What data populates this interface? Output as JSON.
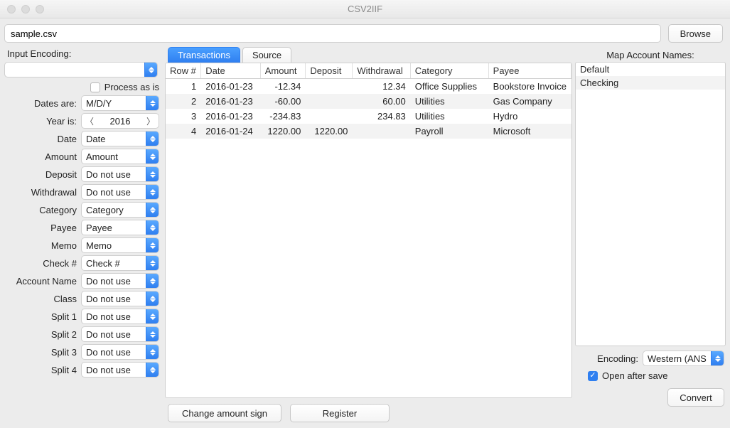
{
  "window": {
    "title": "CSV2IIF"
  },
  "file": {
    "value": "sample.csv",
    "browse_label": "Browse"
  },
  "encoding_label": "Input Encoding:",
  "input_encoding_value": "",
  "process_as_is": {
    "label": "Process as is",
    "checked": false
  },
  "dates_are": {
    "label": "Dates are:",
    "value": "M/D/Y"
  },
  "year_is": {
    "label": "Year is:",
    "value": "2016"
  },
  "mappings": [
    {
      "label": "Date",
      "value": "Date"
    },
    {
      "label": "Amount",
      "value": "Amount"
    },
    {
      "label": "Deposit",
      "value": "Do not use"
    },
    {
      "label": "Withdrawal",
      "value": "Do not use"
    },
    {
      "label": "Category",
      "value": "Category"
    },
    {
      "label": "Payee",
      "value": "Payee"
    },
    {
      "label": "Memo",
      "value": "Memo"
    },
    {
      "label": "Check #",
      "value": "Check #"
    },
    {
      "label": "Account Name",
      "value": "Do not use"
    },
    {
      "label": "Class",
      "value": "Do not use"
    },
    {
      "label": "Split 1",
      "value": "Do not use"
    },
    {
      "label": "Split 2",
      "value": "Do not use"
    },
    {
      "label": "Split 3",
      "value": "Do not use"
    },
    {
      "label": "Split 4",
      "value": "Do not use"
    }
  ],
  "tabs": {
    "transactions": "Transactions",
    "source": "Source"
  },
  "columns": {
    "row": "Row #",
    "date": "Date",
    "amount": "Amount",
    "deposit": "Deposit",
    "withdrawal": "Withdrawal",
    "category": "Category",
    "payee": "Payee"
  },
  "rows": [
    {
      "row": "1",
      "date": "2016-01-23",
      "amount": "-12.34",
      "deposit": "",
      "withdrawal": "12.34",
      "category": "Office Supplies",
      "payee": "Bookstore Invoice"
    },
    {
      "row": "2",
      "date": "2016-01-23",
      "amount": "-60.00",
      "deposit": "",
      "withdrawal": "60.00",
      "category": "Utilities",
      "payee": "Gas Company"
    },
    {
      "row": "3",
      "date": "2016-01-23",
      "amount": "-234.83",
      "deposit": "",
      "withdrawal": "234.83",
      "category": "Utilities",
      "payee": "Hydro"
    },
    {
      "row": "4",
      "date": "2016-01-24",
      "amount": "1220.00",
      "deposit": "1220.00",
      "withdrawal": "",
      "category": "Payroll",
      "payee": "Microsoft"
    }
  ],
  "actions": {
    "change_sign": "Change amount sign",
    "register": "Register",
    "convert": "Convert"
  },
  "right": {
    "title": "Map Account Names:",
    "accounts": [
      "Default",
      "Checking"
    ],
    "encoding_label": "Encoding:",
    "encoding_value": "Western (ANS",
    "open_after": "Open after save",
    "open_after_checked": true
  }
}
